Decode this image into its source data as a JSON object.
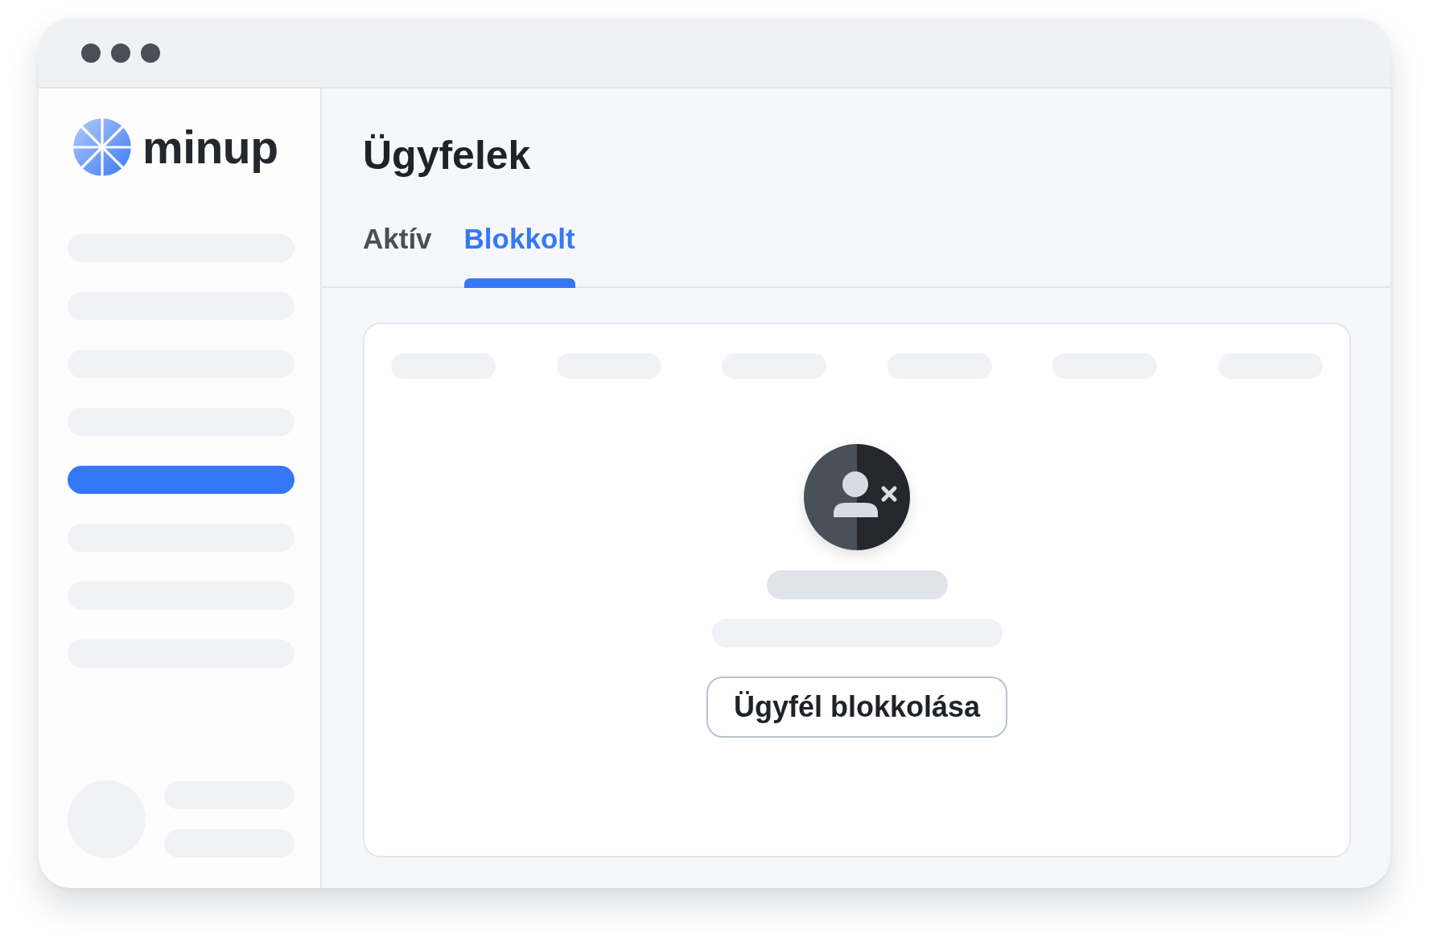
{
  "sidebar": {
    "logo": {
      "text": "minup"
    },
    "nav_items": [
      {
        "selected": false
      },
      {
        "selected": false
      },
      {
        "selected": false
      },
      {
        "selected": false
      },
      {
        "selected": true
      },
      {
        "selected": false
      },
      {
        "selected": false
      },
      {
        "selected": false
      }
    ]
  },
  "main": {
    "title": "Ügyfelek",
    "tabs": [
      {
        "label": "Aktív",
        "selected": false
      },
      {
        "label": "Blokkolt",
        "selected": true
      }
    ],
    "empty_state": {
      "button": "Ügyfél blokkolása"
    }
  }
}
